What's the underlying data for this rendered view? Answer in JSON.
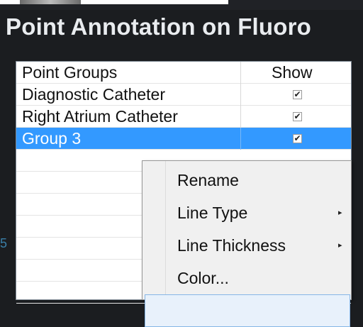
{
  "window": {
    "title": "Point Annotation on Fluoro"
  },
  "table": {
    "headers": {
      "name": "Point Groups",
      "show": "Show"
    },
    "rows": [
      {
        "name": "Diagnostic Catheter",
        "show": "✔"
      },
      {
        "name": "Right Atrium Catheter",
        "show": "✔"
      },
      {
        "name": "Group 3",
        "show": "✔",
        "selected": true
      }
    ]
  },
  "side_fragment": "5",
  "context_menu": {
    "items": [
      {
        "label": "Rename",
        "submenu": ""
      },
      {
        "label": "Line Type",
        "submenu": "▸"
      },
      {
        "label": "Line Thickness",
        "submenu": "▸"
      },
      {
        "label": "Color...",
        "submenu": ""
      },
      {
        "label": "",
        "submenu": ""
      }
    ]
  },
  "colors": {
    "selection": "#3399ff",
    "title_bg": "#1b1d20",
    "title_text": "#e9ecef"
  }
}
